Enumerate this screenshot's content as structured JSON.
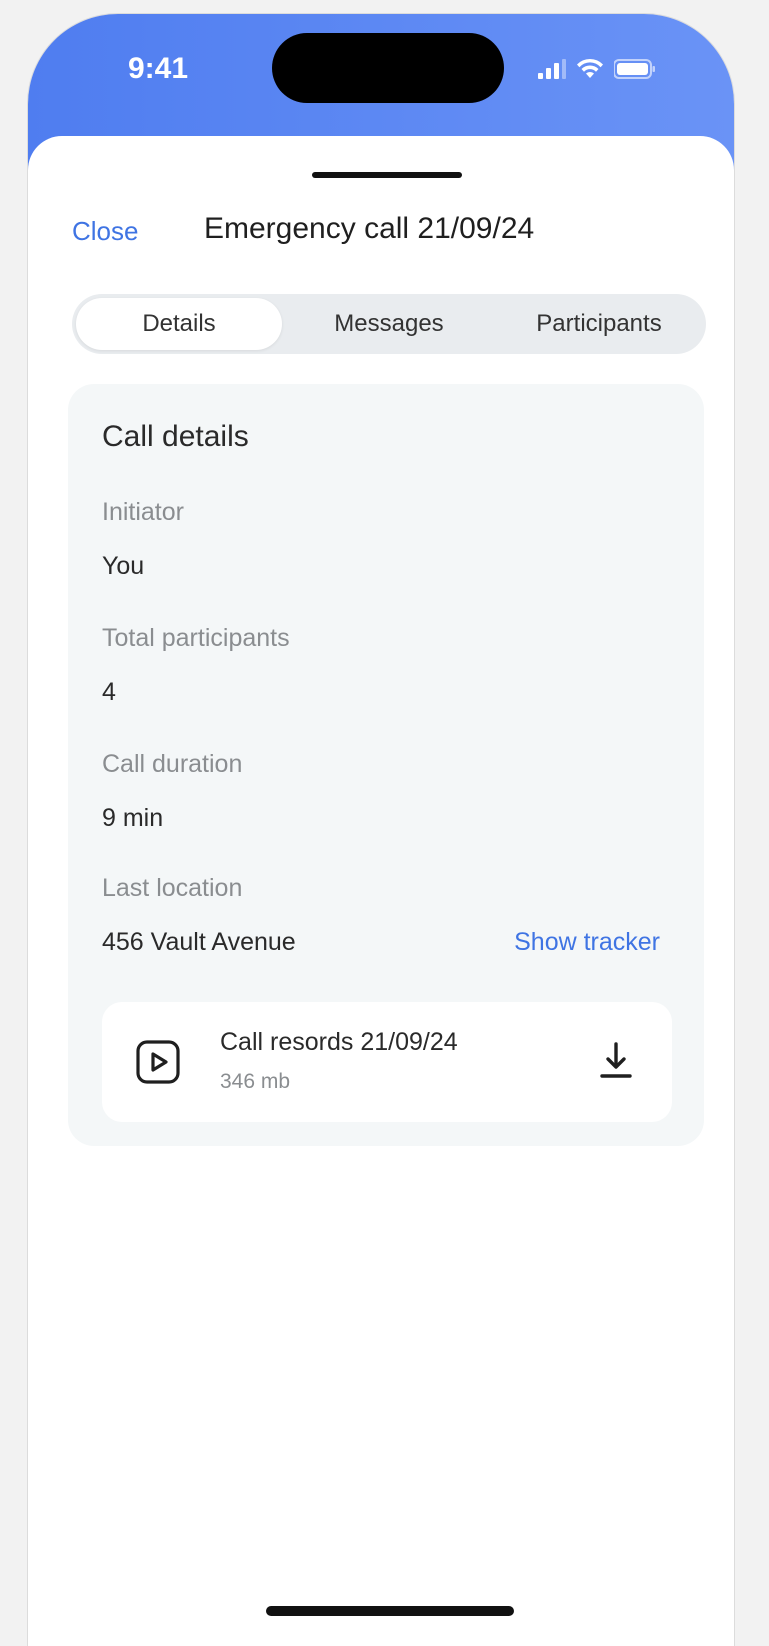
{
  "status_bar": {
    "time": "9:41"
  },
  "header": {
    "close_label": "Close",
    "title": "Emergency call 21/09/24"
  },
  "tabs": [
    {
      "label": "Details",
      "active": true
    },
    {
      "label": "Messages",
      "active": false
    },
    {
      "label": "Participants",
      "active": false
    }
  ],
  "details": {
    "title": "Call details",
    "fields": [
      {
        "label": "Initiator",
        "value": "You"
      },
      {
        "label": "Total participants",
        "value": "4"
      },
      {
        "label": "Call duration",
        "value": "9 min"
      },
      {
        "label": "Last location",
        "value": "456 Vault Avenue"
      }
    ],
    "show_tracker_label": "Show tracker"
  },
  "recording": {
    "name": "Call resords 21/09/24",
    "size": "346 mb",
    "icon": "play-icon",
    "action_icon": "download-icon"
  },
  "colors": {
    "accent": "#3f74e3",
    "header_gradient_start": "#4f7df0",
    "header_gradient_end": "#6a93f6",
    "card_bg": "#f4f7f8"
  }
}
